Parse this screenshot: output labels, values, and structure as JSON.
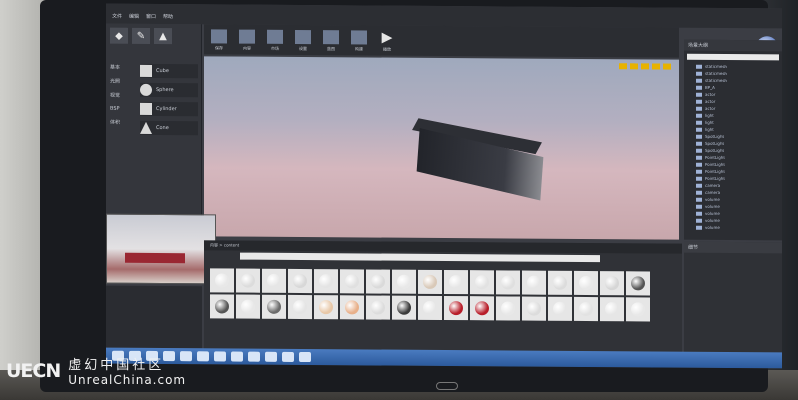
{
  "menu": [
    "文件",
    "编辑",
    "窗口",
    "帮助"
  ],
  "modes": [
    "◆",
    "✎",
    "▲"
  ],
  "categories": [
    "基本",
    "光照",
    "视觉",
    "BSP",
    "体积"
  ],
  "places": [
    {
      "label": "Cube",
      "shape": "cube"
    },
    {
      "label": "Sphere",
      "shape": "sphere"
    },
    {
      "label": "Cylinder",
      "shape": "cylinder"
    },
    {
      "label": "Cone",
      "shape": "cone"
    }
  ],
  "toolbar": [
    "保存",
    "内容",
    "市场",
    "设置",
    "蓝图",
    "构建",
    "播放"
  ],
  "outliner": {
    "title": "场景大纲",
    "rows": [
      "staticmesh",
      "staticmesh",
      "staticmesh",
      "BP_A",
      "actor",
      "actor",
      "actor",
      "light",
      "light",
      "light",
      "SpotLight",
      "SpotLight",
      "SpotLight",
      "PointLight",
      "PointLight",
      "PointLight",
      "PointLight",
      "camera",
      "camera",
      "volume",
      "volume",
      "volume",
      "volume",
      "volume"
    ]
  },
  "details": {
    "title": "细节"
  },
  "content": {
    "bar": "内容    >    content",
    "materials": [
      "#e8e8e8",
      "#dcdcdc",
      "#e6e6e6",
      "#d8d8d8",
      "#e4e4e4",
      "#e0e0e0",
      "#dadada",
      "#e8e8e8",
      "#d9c9b8",
      "#e6e6e6",
      "#e2e2e2",
      "#dfdfdf",
      "#e6e6e6",
      "#dcdcdc",
      "#e8e8e8",
      "#d6d6d6",
      "#555555",
      "#555555",
      "#e8e8e8",
      "#6b6b6b",
      "#e4e4e4",
      "#e8c8a8",
      "#e8b08a",
      "#dcdcdc",
      "#3b3b3b",
      "#e6e6e6",
      "#b81e2a",
      "#b81e2a",
      "#e8e8e8",
      "#dcdcdc",
      "#e6e6e6",
      "#e2e2e2",
      "#e6e6e6",
      "#e8e8e8"
    ]
  },
  "watermark": {
    "logo": "UECN",
    "cn": "虚幻中国社区",
    "en": "UnrealChina.com"
  }
}
